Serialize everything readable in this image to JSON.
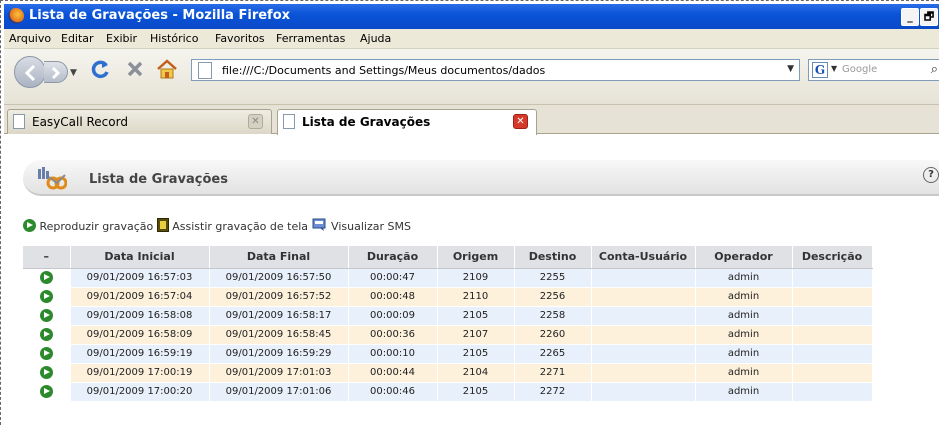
{
  "window": {
    "title": "Lista de Gravações - Mozilla Firefox",
    "minimize_label": "_",
    "maximize_label": "🗗"
  },
  "menu": [
    "Arquivo",
    "Editar",
    "Exibir",
    "Histórico",
    "Favoritos",
    "Ferramentas",
    "Ajuda"
  ],
  "nav": {
    "url": "file:///C:/Documents and Settings/Meus documentos/dados",
    "search_placeholder": "Google",
    "search_engine_icon": "G"
  },
  "tabs": [
    {
      "label": "EasyCall Record",
      "active": false
    },
    {
      "label": "Lista de Gravações",
      "active": true
    }
  ],
  "page": {
    "title": "Lista de Gravações",
    "help_label": "?"
  },
  "legend": {
    "play": "Reproduzir gravação",
    "screen": "Assistir gravação de tela",
    "sms": "Visualizar SMS"
  },
  "table": {
    "columns": [
      "–",
      "Data Inicial",
      "Data Final",
      "Duração",
      "Origem",
      "Destino",
      "Conta-Usuário",
      "Operador",
      "Descrição"
    ],
    "rows": [
      [
        "09/01/2009 16:57:03",
        "09/01/2009 16:57:50",
        "00:00:47",
        "2109",
        "2255",
        "",
        "admin",
        ""
      ],
      [
        "09/01/2009 16:57:04",
        "09/01/2009 16:57:52",
        "00:00:48",
        "2110",
        "2256",
        "",
        "admin",
        ""
      ],
      [
        "09/01/2009 16:58:08",
        "09/01/2009 16:58:17",
        "00:00:09",
        "2105",
        "2258",
        "",
        "admin",
        ""
      ],
      [
        "09/01/2009 16:58:09",
        "09/01/2009 16:58:45",
        "00:00:36",
        "2107",
        "2260",
        "",
        "admin",
        ""
      ],
      [
        "09/01/2009 16:59:19",
        "09/01/2009 16:59:29",
        "00:00:10",
        "2105",
        "2265",
        "",
        "admin",
        ""
      ],
      [
        "09/01/2009 17:00:19",
        "09/01/2009 17:01:03",
        "00:00:44",
        "2104",
        "2271",
        "",
        "admin",
        ""
      ],
      [
        "09/01/2009 17:00:20",
        "09/01/2009 17:01:06",
        "00:00:46",
        "2105",
        "2272",
        "",
        "admin",
        ""
      ]
    ]
  }
}
